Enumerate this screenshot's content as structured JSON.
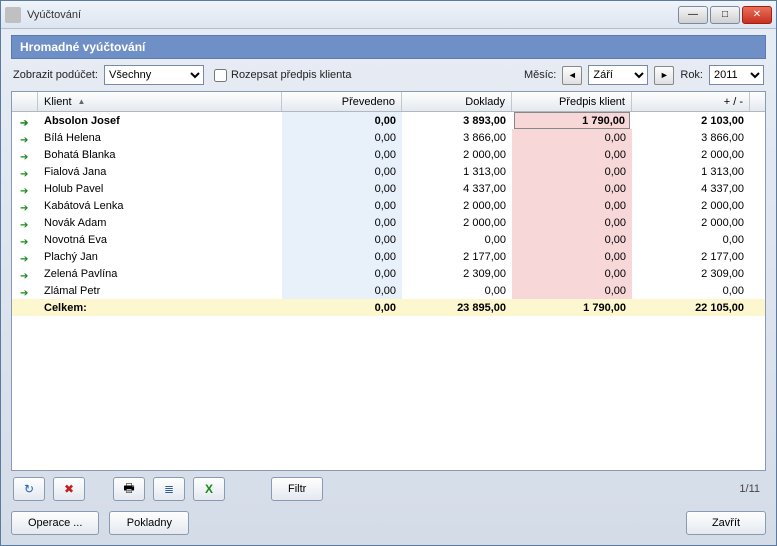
{
  "window": {
    "title": "Vyúčtování"
  },
  "section_title": "Hromadné vyúčtování",
  "labels": {
    "subaccount": "Zobrazit podúčet:",
    "expand_rule": "Rozepsat předpis klienta",
    "month": "Měsíc:",
    "year": "Rok:"
  },
  "subaccount_value": "Všechny",
  "month_value": "Září",
  "year_value": "2011",
  "columns": {
    "client": "Klient",
    "transferred": "Převedeno",
    "documents": "Doklady",
    "client_rule": "Předpis klient",
    "diff": "+ / -"
  },
  "rows": [
    {
      "client": "Absolon Josef",
      "transferred": "0,00",
      "documents": "3 893,00",
      "client_rule": "1 790,00",
      "diff": "2 103,00",
      "bold": true,
      "editable_rule": true
    },
    {
      "client": "Bílá Helena",
      "transferred": "0,00",
      "documents": "3 866,00",
      "client_rule": "0,00",
      "diff": "3 866,00"
    },
    {
      "client": "Bohatá Blanka",
      "transferred": "0,00",
      "documents": "2 000,00",
      "client_rule": "0,00",
      "diff": "2 000,00"
    },
    {
      "client": "Fialová Jana",
      "transferred": "0,00",
      "documents": "1 313,00",
      "client_rule": "0,00",
      "diff": "1 313,00"
    },
    {
      "client": "Holub Pavel",
      "transferred": "0,00",
      "documents": "4 337,00",
      "client_rule": "0,00",
      "diff": "4 337,00"
    },
    {
      "client": "Kabátová Lenka",
      "transferred": "0,00",
      "documents": "2 000,00",
      "client_rule": "0,00",
      "diff": "2 000,00"
    },
    {
      "client": "Novák Adam",
      "transferred": "0,00",
      "documents": "2 000,00",
      "client_rule": "0,00",
      "diff": "2 000,00"
    },
    {
      "client": "Novotná Eva",
      "transferred": "0,00",
      "documents": "0,00",
      "client_rule": "0,00",
      "diff": "0,00"
    },
    {
      "client": "Plachý Jan",
      "transferred": "0,00",
      "documents": "2 177,00",
      "client_rule": "0,00",
      "diff": "2 177,00"
    },
    {
      "client": "Zelená Pavlína",
      "transferred": "0,00",
      "documents": "2 309,00",
      "client_rule": "0,00",
      "diff": "2 309,00"
    },
    {
      "client": "Zlámal Petr",
      "transferred": "0,00",
      "documents": "0,00",
      "client_rule": "0,00",
      "diff": "0,00"
    }
  ],
  "total": {
    "label": "Celkem:",
    "transferred": "0,00",
    "documents": "23 895,00",
    "client_rule": "1 790,00",
    "diff": "22 105,00"
  },
  "buttons": {
    "filter": "Filtr",
    "operations": "Operace ...",
    "cashdesks": "Pokladny",
    "close": "Zavřít"
  },
  "pager": "1/11",
  "icons": {
    "refresh": "↻",
    "delete": "✖",
    "print": "🖶",
    "list": "≣",
    "excel": "X",
    "prev": "◄",
    "next": "►",
    "edit": "✎"
  }
}
